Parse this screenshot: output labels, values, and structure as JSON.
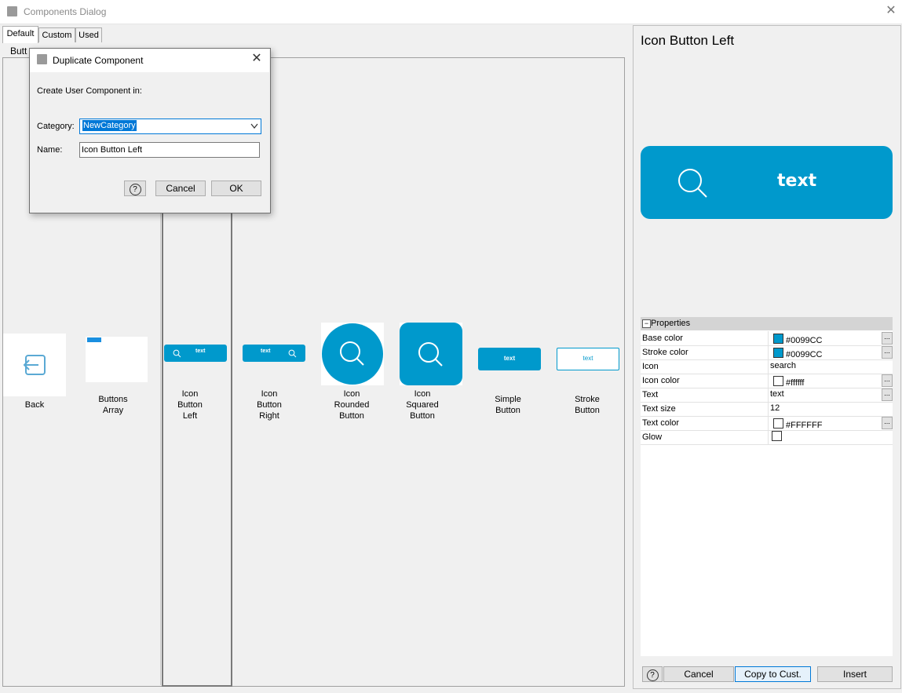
{
  "window": {
    "title": "Components Dialog",
    "close_glyph": "✕"
  },
  "tabs": [
    {
      "label": "Default",
      "active": true
    },
    {
      "label": "Custom",
      "active": false
    },
    {
      "label": "Used",
      "active": false
    }
  ],
  "section": {
    "label": "Butt"
  },
  "components": [
    {
      "label_lines": [
        "Back"
      ],
      "icon": "back-arrow-icon"
    },
    {
      "label_lines": [
        "Buttons",
        "Array"
      ],
      "icon": "buttons-array-icon"
    },
    {
      "label_lines": [
        "Icon",
        "Button",
        "Left"
      ],
      "thumb_text": "text",
      "icon": "search-icon"
    },
    {
      "label_lines": [
        "Icon",
        "Button",
        "Right"
      ],
      "thumb_text": "text",
      "icon": "search-icon"
    },
    {
      "label_lines": [
        "Icon",
        "Rounded",
        "Button"
      ],
      "icon": "search-icon"
    },
    {
      "label_lines": [
        "Icon",
        "Squared",
        "Button"
      ],
      "icon": "search-icon"
    },
    {
      "label_lines": [
        "Simple",
        "Button"
      ],
      "thumb_text": "text"
    },
    {
      "label_lines": [
        "Stroke",
        "Button"
      ],
      "thumb_text": "text"
    }
  ],
  "preview": {
    "title": "Icon Button Left",
    "button_text": "text",
    "icon": "search-icon"
  },
  "properties": {
    "header": "Properties",
    "collapse_glyph": "−",
    "rows": [
      {
        "key": "Base color",
        "value": "#0099CC",
        "swatch": "#0099CC",
        "ellipsis": true
      },
      {
        "key": "Stroke color",
        "value": "#0099CC",
        "swatch": "#0099CC",
        "ellipsis": true
      },
      {
        "key": "Icon",
        "value": "search"
      },
      {
        "key": "Icon color",
        "value": "#ffffff",
        "swatch": "#ffffff",
        "ellipsis": true
      },
      {
        "key": "Text",
        "value": "text",
        "ellipsis": true
      },
      {
        "key": "Text size",
        "value": "12"
      },
      {
        "key": "Text color",
        "value": "#FFFFFF",
        "swatch": "#FFFFFF",
        "ellipsis": true
      },
      {
        "key": "Glow",
        "value": "",
        "checkbox": true
      }
    ],
    "ellipsis_glyph": "..."
  },
  "footer": {
    "help_glyph": "?",
    "cancel": "Cancel",
    "copy": "Copy to Cust.",
    "insert": "Insert"
  },
  "dialog": {
    "title": "Duplicate Component",
    "close_glyph": "✕",
    "prompt": "Create User Component in:",
    "category_label": "Category:",
    "category_value": "NewCategory",
    "name_label": "Name:",
    "name_value": "Icon Button Left",
    "help_glyph": "?",
    "cancel": "Cancel",
    "ok": "OK"
  },
  "colors": {
    "accent": "#0099CC",
    "focus": "#0078d7"
  }
}
